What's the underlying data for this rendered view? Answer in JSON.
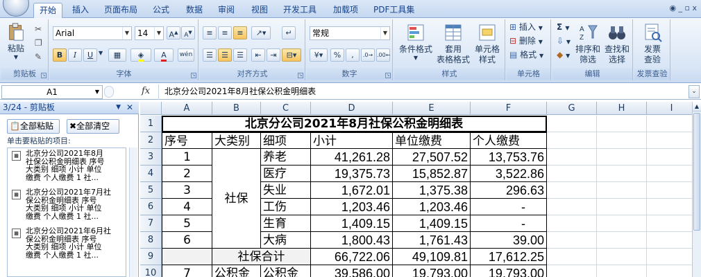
{
  "tabs": [
    "开始",
    "插入",
    "页面布局",
    "公式",
    "数据",
    "审阅",
    "视图",
    "开发工具",
    "加载项",
    "PDF工具集"
  ],
  "active_tab": "开始",
  "window_controls": "◉ _ ▫ x",
  "ribbon": {
    "clipboard": {
      "paste": "粘贴",
      "group": "剪贴板"
    },
    "font": {
      "name": "Arial",
      "size": "14",
      "grow": "A",
      "shrink": "A",
      "bold": "B",
      "italic": "I",
      "underline": "U",
      "group": "字体"
    },
    "alignment": {
      "group": "对齐方式"
    },
    "number": {
      "format": "常规",
      "percent": "%",
      "comma": ",",
      "group": "数字"
    },
    "styles": {
      "cond": "条件格式",
      "table": [
        "套用",
        "表格格式"
      ],
      "cell": [
        "单元格",
        "样式"
      ],
      "group": "样式"
    },
    "cells": {
      "insert": "插入",
      "delete": "删除",
      "format": "格式",
      "group": "单元格"
    },
    "editing": {
      "sum": "Σ",
      "sort": [
        "排序和",
        "筛选"
      ],
      "find": [
        "查找和",
        "选择"
      ],
      "group": "编辑"
    },
    "invoice": {
      "label": [
        "发票",
        "查验"
      ],
      "group": "发票查验"
    }
  },
  "formula_bar": {
    "name_box": "A1",
    "fx": "fx",
    "formula": "北京分公司2021年8月社保公积金明细表"
  },
  "clipboard_pane": {
    "title": "3/24 - 剪贴板",
    "paste_all": "全部粘贴",
    "clear_all": "全部清空",
    "prompt": "单击要粘贴的项目:",
    "items": [
      {
        "lines": [
          "北京分公司2021年8月",
          "社保公积金明细表 序号",
          "大类别 细项 小计 单位",
          "缴费 个人缴费 1 社..."
        ]
      },
      {
        "lines": [
          "北京分公司2021年7月社",
          "保公积金明细表 序号",
          "大类别 细项 小计 单位",
          "缴费 个人缴费 1 社..."
        ]
      },
      {
        "lines": [
          "北京分公司2021年6月社",
          "保公积金明细表 序号",
          "大类别 细项 小计 单位",
          "缴费 个人缴费 1 社..."
        ]
      }
    ]
  },
  "sheet": {
    "columns": [
      "A",
      "B",
      "C",
      "D",
      "E",
      "F",
      "G",
      "H",
      "I"
    ],
    "rows": [
      "1",
      "2",
      "3",
      "4",
      "5",
      "6",
      "7",
      "8",
      "9",
      "10"
    ],
    "title": "北京分公司2021年8月社保公积金明细表",
    "headers": [
      "序号",
      "大类别",
      "细项",
      "小计",
      "单位缴费",
      "个人缴费"
    ],
    "category_shebao": "社保",
    "data": [
      [
        "1",
        "养老",
        "41,261.28",
        "27,507.52",
        "13,753.76"
      ],
      [
        "2",
        "医疗",
        "19,375.73",
        "15,852.87",
        "3,522.86"
      ],
      [
        "3",
        "失业",
        "1,672.01",
        "1,375.38",
        "296.63"
      ],
      [
        "4",
        "工伤",
        "1,203.46",
        "1,203.46",
        "-"
      ],
      [
        "5",
        "生育",
        "1,409.15",
        "1,409.15",
        "-"
      ],
      [
        "6",
        "大病",
        "1,800.43",
        "1,761.43",
        "39.00"
      ]
    ],
    "subtotal": {
      "label": "社保合计",
      "values": [
        "66,722.06",
        "49,109.81",
        "17,612.25"
      ]
    },
    "row10": [
      "7",
      "公积金",
      "公积金",
      "39,586.00",
      "19,793.00",
      "19,793.00"
    ]
  },
  "colors": {
    "ribbon_bg": "#d9e6f6",
    "tab_text": "#15428b",
    "selected": "#f6c45d"
  }
}
